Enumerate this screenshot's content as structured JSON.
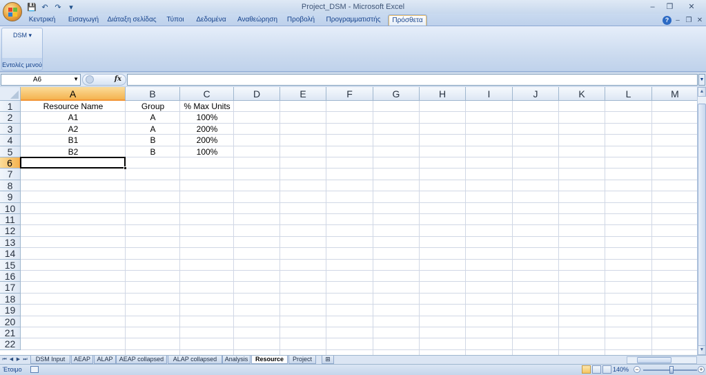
{
  "app": {
    "title": "Project_DSM - Microsoft Excel",
    "qat": [
      {
        "name": "save-icon",
        "glyph": "💾"
      },
      {
        "name": "undo-icon",
        "glyph": "↶"
      },
      {
        "name": "redo-icon",
        "glyph": "↷"
      },
      {
        "name": "customize-icon",
        "glyph": "▾"
      }
    ],
    "window_controls": {
      "minimize": "–",
      "restore": "❐",
      "close": "✕"
    },
    "doc_controls": {
      "help": "?",
      "minimize": "–",
      "restore": "❐",
      "close": "✕"
    }
  },
  "ribbon": {
    "tabs": [
      "Κεντρική",
      "Εισαγωγή",
      "Διάταξη σελίδας",
      "Τύποι",
      "Δεδομένα",
      "Αναθεώρηση",
      "Προβολή",
      "Προγραμματιστής",
      "Πρόσθετα"
    ],
    "active_tab": "Πρόσθετα",
    "group": {
      "label": "Εντολές μενού",
      "button": "DSM ▾"
    }
  },
  "formula_bar": {
    "name_box": "A6",
    "fx": "fx",
    "formula": ""
  },
  "grid": {
    "columns": [
      "A",
      "B",
      "C",
      "D",
      "E",
      "F",
      "G",
      "H",
      "I",
      "J",
      "K",
      "L",
      "M"
    ],
    "rows": [
      "1",
      "2",
      "3",
      "4",
      "5",
      "6",
      "7",
      "8",
      "9",
      "10",
      "11",
      "12",
      "13",
      "14",
      "15",
      "16",
      "17",
      "18",
      "19",
      "20",
      "21",
      "22"
    ],
    "selected_column": "A",
    "selected_row": "6",
    "data": [
      [
        "Resource Name",
        "Group",
        "% Max Units"
      ],
      [
        "A1",
        "A",
        "100%"
      ],
      [
        "A2",
        "A",
        "200%"
      ],
      [
        "B1",
        "B",
        "200%"
      ],
      [
        "B2",
        "B",
        "100%"
      ]
    ]
  },
  "sheets": {
    "tabs": [
      "DSM Input",
      "AEAP",
      "ALAP",
      "AEAP collapsed",
      "ALAP collapsed",
      "Analysis",
      "Resource",
      "Project"
    ],
    "active": "Resource"
  },
  "status": {
    "text": "Έτοιμο",
    "zoom": "140%"
  }
}
